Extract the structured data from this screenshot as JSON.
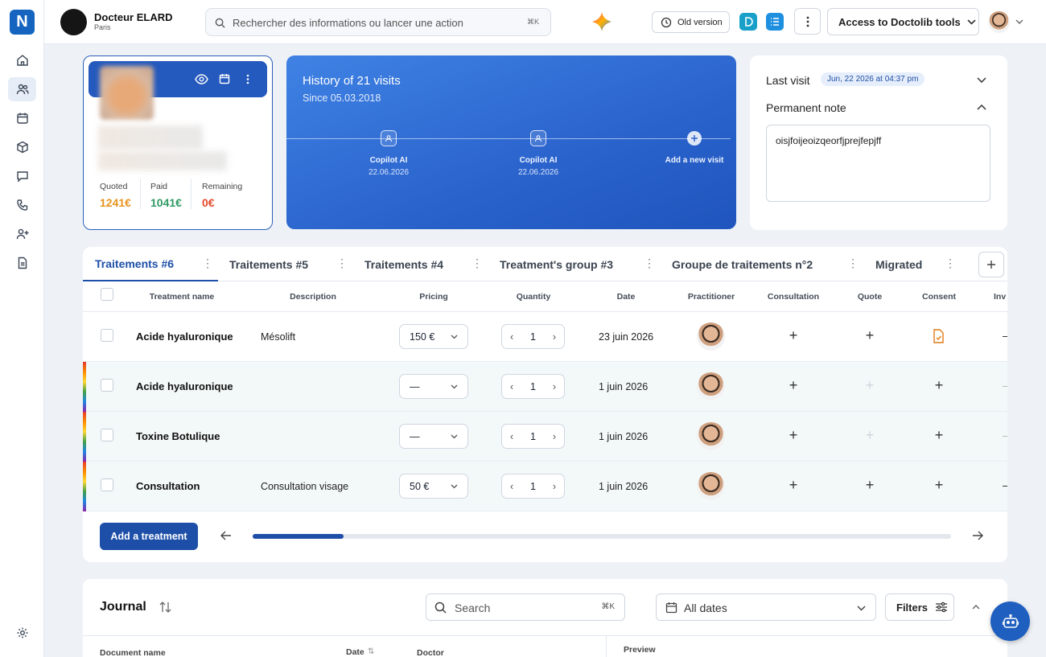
{
  "sidebar": {
    "logo_text": "N",
    "items": [
      {
        "icon": "home-icon"
      },
      {
        "icon": "patients-icon"
      },
      {
        "icon": "calendar-icon"
      },
      {
        "icon": "box-icon"
      },
      {
        "icon": "chat-icon"
      },
      {
        "icon": "phone-icon"
      },
      {
        "icon": "add-user-icon"
      },
      {
        "icon": "document-icon"
      }
    ],
    "settings_icon": "gear-icon"
  },
  "topbar": {
    "doctor_name": "Docteur ELARD",
    "doctor_city": "Paris",
    "search_placeholder": "Rechercher des informations ou lancer une action",
    "search_shortcut": "⌘K",
    "old_version_label": "Old version",
    "doctolib_tools_label": "Access to Doctolib tools"
  },
  "patient_card": {
    "quoted_label": "Quoted",
    "quoted_value": "1241€",
    "paid_label": "Paid",
    "paid_value": "1041€",
    "remaining_label": "Remaining",
    "remaining_value": "0€",
    "colors": {
      "quoted": "#e8931e",
      "paid": "#2e9b63",
      "remaining": "#e5492b"
    }
  },
  "history": {
    "title": "History of 21 visits",
    "since": "Since 05.03.2018",
    "visits": [
      {
        "label": "Copilot AI",
        "date": "22.06.2026"
      },
      {
        "label": "Copilot AI",
        "date": "22.06.2026"
      }
    ],
    "add_label": "Add a new visit"
  },
  "right_panel": {
    "last_visit_label": "Last visit",
    "last_visit_badge": "Jun, 22 2026 at 04:37 pm",
    "permanent_note_label": "Permanent note",
    "note_text": "oisjfoijeoizqeorfjprejfepjff"
  },
  "treatments": {
    "tabs": [
      "Traitements #6",
      "Traitements #5",
      "Traitements #4",
      "Treatment's group #3",
      "Groupe de traitements n°2",
      "Migrated"
    ],
    "columns": [
      "Treatment name",
      "Description",
      "Pricing",
      "Quantity",
      "Date",
      "Practitioner",
      "Consultation",
      "Quote",
      "Consent",
      "Inv"
    ],
    "rows": [
      {
        "name": "Acide hyaluronique",
        "description": "Mésolift",
        "pricing": "150 €",
        "quantity": "1",
        "date": "23 juin 2026"
      },
      {
        "name": "Acide hyaluronique",
        "description": "",
        "pricing": "—",
        "quantity": "1",
        "date": "1 juin 2026"
      },
      {
        "name": "Toxine Botulique",
        "description": "",
        "pricing": "—",
        "quantity": "1",
        "date": "1 juin 2026"
      },
      {
        "name": "Consultation",
        "description": "Consultation visage",
        "pricing": "50 €",
        "quantity": "1",
        "date": "1 juin 2026"
      }
    ],
    "add_button_label": "Add a treatment",
    "scroll_progress": 0.13
  },
  "journal": {
    "title": "Journal",
    "search_placeholder": "Search",
    "search_shortcut": "⌘K",
    "dates_label": "All dates",
    "filters_label": "Filters",
    "columns": [
      "Document name",
      "Date",
      "Doctor"
    ],
    "preview_label": "Preview"
  }
}
